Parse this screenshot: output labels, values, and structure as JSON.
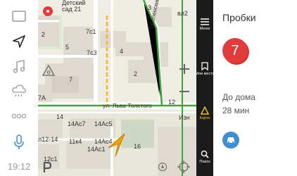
{
  "rail": {
    "time": "19:12",
    "icons": [
      "tablet-frame-icon",
      "navigation-arrow-icon",
      "music-note-icon",
      "weather-cloud-icon",
      "more-dots-icon",
      "microphone-icon"
    ]
  },
  "map": {
    "header_text": "Детский сад 21",
    "labels": {
      "b3": "3",
      "b2": "2",
      "b7c1": "7с1",
      "b5": "5",
      "b7c3": "7с3",
      "b4": "4",
      "b2b": "2",
      "b7": "7",
      "b7a": "7А",
      "b12": "12",
      "b14": "14",
      "b14ac7": "14Ас7",
      "b14ac5": "14Ас5",
      "b12_14": "л12-14",
      "b11k4": "11к4",
      "b14ac4": "14Ас4",
      "b14ac1": "14Ас1",
      "b16": "16",
      "b12c1": "12с1",
      "vl2": "вл2",
      "izh": "Изн"
    },
    "street_tolstoy": "ул. Льва Толстого",
    "street_oblast": "Оболенский пер."
  },
  "dark_bar": {
    "items": [
      {
        "label": "Меню",
        "icon": "menu-icon"
      },
      {
        "label": "Мои места",
        "icon": "bookmark-icon"
      },
      {
        "label": "Карта",
        "icon": "map-cone-icon"
      },
      {
        "label": "Поиск",
        "icon": "search-icon"
      }
    ],
    "active_color": "#f5c518"
  },
  "panel": {
    "title": "Пробки",
    "jam_level": "7",
    "home_label": "До дома",
    "home_time": "28 мин",
    "jam_color": "#e13b3b",
    "car_color": "#3d8fd1"
  }
}
